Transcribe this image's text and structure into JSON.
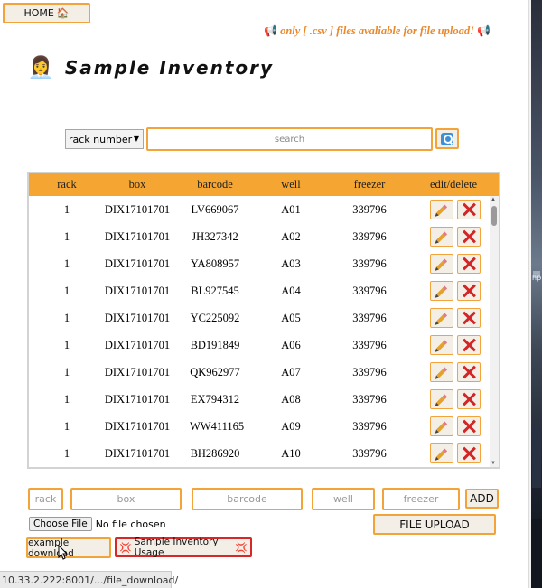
{
  "nav": {
    "home_label": "HOME",
    "home_icon": "🏠"
  },
  "notice": {
    "icon": "📢",
    "text": "only [ .csv ] files avaliable for file upload!"
  },
  "header": {
    "icon": "👩‍💼",
    "title": "Sample Inventory"
  },
  "search": {
    "field_selected": "rack number",
    "placeholder": "search",
    "button_icon": "search-icon"
  },
  "table": {
    "columns": [
      "rack",
      "box",
      "barcode",
      "well",
      "freezer",
      "edit/delete"
    ],
    "rows": [
      {
        "rack": "1",
        "box": "DIX17101701",
        "barcode": "LV669067",
        "well": "A01",
        "freezer": "339796"
      },
      {
        "rack": "1",
        "box": "DIX17101701",
        "barcode": "JH327342",
        "well": "A02",
        "freezer": "339796"
      },
      {
        "rack": "1",
        "box": "DIX17101701",
        "barcode": "YA808957",
        "well": "A03",
        "freezer": "339796"
      },
      {
        "rack": "1",
        "box": "DIX17101701",
        "barcode": "BL927545",
        "well": "A04",
        "freezer": "339796"
      },
      {
        "rack": "1",
        "box": "DIX17101701",
        "barcode": "YC225092",
        "well": "A05",
        "freezer": "339796"
      },
      {
        "rack": "1",
        "box": "DIX17101701",
        "barcode": "BD191849",
        "well": "A06",
        "freezer": "339796"
      },
      {
        "rack": "1",
        "box": "DIX17101701",
        "barcode": "QK962977",
        "well": "A07",
        "freezer": "339796"
      },
      {
        "rack": "1",
        "box": "DIX17101701",
        "barcode": "EX794312",
        "well": "A08",
        "freezer": "339796"
      },
      {
        "rack": "1",
        "box": "DIX17101701",
        "barcode": "WW411165",
        "well": "A09",
        "freezer": "339796"
      },
      {
        "rack": "1",
        "box": "DIX17101701",
        "barcode": "BH286920",
        "well": "A10",
        "freezer": "339796"
      }
    ]
  },
  "add_form": {
    "rack_placeholder": "rack",
    "box_placeholder": "box",
    "barcode_placeholder": "barcode",
    "well_placeholder": "well",
    "freezer_placeholder": "freezer",
    "add_label": "ADD"
  },
  "file": {
    "choose_label": "Choose File",
    "status": "No file chosen",
    "upload_label": "FILE UPLOAD"
  },
  "footer": {
    "example_label": "example download",
    "usage_label": "Sample Inventory Usage",
    "usage_icon": "💢"
  },
  "status_bar": {
    "url": "10.33.2.222:8001/.../file_download/"
  },
  "desktop": {
    "fragment": "hp"
  },
  "colors": {
    "accent": "#f5a532",
    "notice": "#e8892c",
    "danger": "#d62828"
  }
}
